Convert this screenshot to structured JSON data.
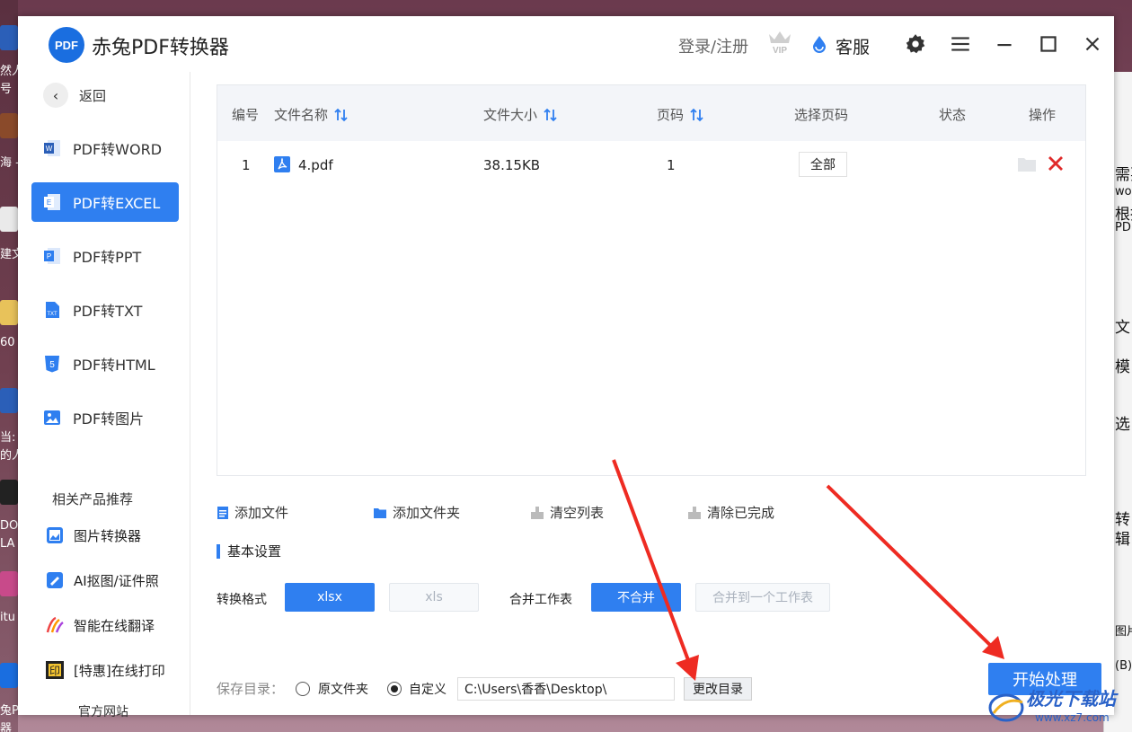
{
  "app": {
    "logo_text": "PDF",
    "title": "赤兔PDF转换器"
  },
  "header": {
    "login": "登录/注册",
    "vip": "VIP",
    "service": "客服"
  },
  "sidebar": {
    "back": "返回",
    "items": [
      {
        "label": "PDF转WORD",
        "icon": "word-icon",
        "active": false
      },
      {
        "label": "PDF转EXCEL",
        "icon": "excel-icon",
        "active": true
      },
      {
        "label": "PDF转PPT",
        "icon": "ppt-icon",
        "active": false
      },
      {
        "label": "PDF转TXT",
        "icon": "txt-icon",
        "active": false
      },
      {
        "label": "PDF转HTML",
        "icon": "html-icon",
        "active": false
      },
      {
        "label": "PDF转图片",
        "icon": "image-icon",
        "active": false
      }
    ],
    "recommend_title": "相关产品推荐",
    "recommend": [
      {
        "label": "图片转换器",
        "icon": "picture-converter-icon"
      },
      {
        "label": "AI抠图/证件照",
        "icon": "ai-cutout-icon"
      },
      {
        "label": "智能在线翻译",
        "icon": "translate-icon"
      },
      {
        "label": "[特惠]在线打印",
        "icon": "print-icon"
      }
    ],
    "official": "官方网站"
  },
  "table": {
    "headers": {
      "num": "编号",
      "name": "文件名称",
      "size": "文件大小",
      "pages": "页码",
      "select": "选择页码",
      "status": "状态",
      "ops": "操作"
    },
    "rows": [
      {
        "num": "1",
        "name": "4.pdf",
        "size": "38.15KB",
        "pages": "1",
        "select": "全部",
        "status": ""
      }
    ]
  },
  "actions": {
    "add_file": "添加文件",
    "add_folder": "添加文件夹",
    "clear_list": "清空列表",
    "clear_done": "清除已完成"
  },
  "settings": {
    "title": "基本设置",
    "format_label": "转换格式",
    "format_options": [
      "xlsx",
      "xls"
    ],
    "format_selected": "xlsx",
    "merge_label": "合并工作表",
    "merge_options": [
      "不合并",
      "合并到一个工作表"
    ],
    "merge_selected": "不合并"
  },
  "save": {
    "label": "保存目录：",
    "opt_original": "原文件夹",
    "opt_custom": "自定义",
    "selected": "自定义",
    "path": "C:\\Users\\香香\\Desktop\\",
    "change_btn": "更改目录"
  },
  "start_btn": "开始处理",
  "watermark": {
    "text": "极光下载站",
    "url": "www.xz7.com"
  },
  "desktop": {
    "left_texts": [
      "然人",
      "号",
      "海 -",
      "建文",
      "60",
      "当:",
      "的人",
      "DOI",
      "LA",
      "itu",
      "兔P",
      "器"
    ],
    "right_texts": [
      "需要",
      "wor",
      "根据",
      "PDI",
      "文",
      "模",
      "选",
      "转",
      "辑",
      "图片",
      "(B)"
    ]
  },
  "colors": {
    "accent": "#2f7ff0",
    "delete": "#e02b2b",
    "arrow": "#ee2b22"
  }
}
